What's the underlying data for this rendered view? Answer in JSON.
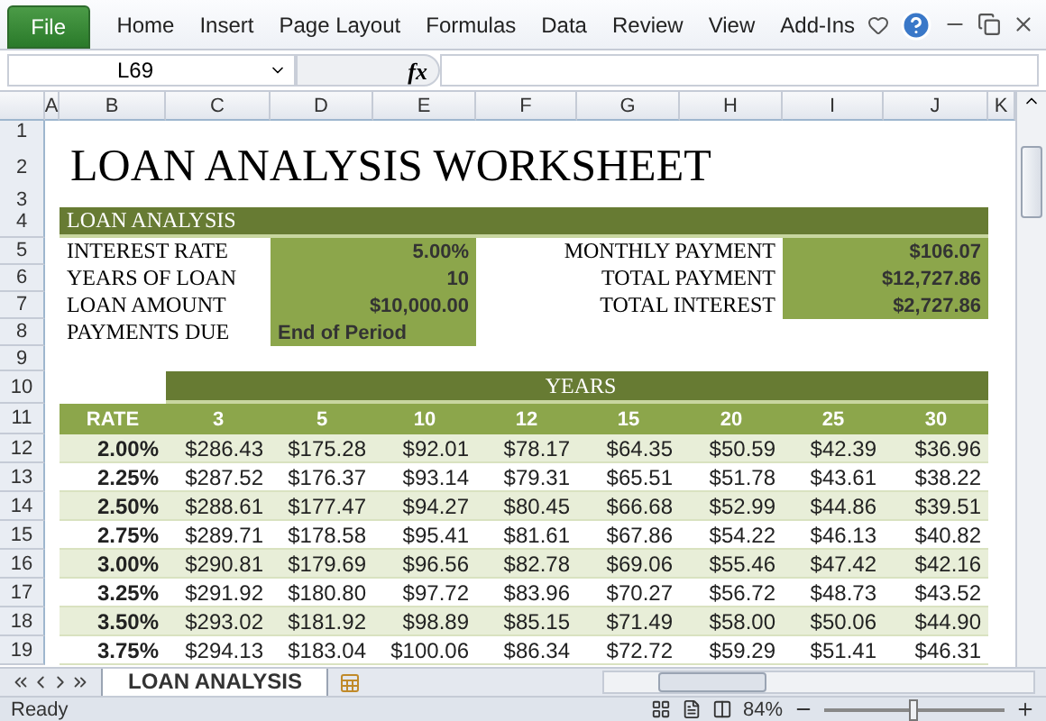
{
  "ribbon": {
    "file_tab": "File",
    "tabs": [
      "Home",
      "Insert",
      "Page Layout",
      "Formulas",
      "Data",
      "Review",
      "View",
      "Add-Ins"
    ]
  },
  "formula_bar": {
    "name_box": "L69",
    "function_label": "fx"
  },
  "columns": [
    "A",
    "B",
    "C",
    "D",
    "E",
    "F",
    "G",
    "H",
    "I",
    "J",
    "K"
  ],
  "row_numbers": [
    "1",
    "2",
    "3",
    "4",
    "5",
    "6",
    "7",
    "8",
    "9",
    "10",
    "11",
    "12",
    "13",
    "14",
    "15",
    "16",
    "17",
    "18",
    "19"
  ],
  "title": "LOAN ANALYSIS WORKSHEET",
  "section": "LOAN ANALYSIS",
  "inputs": [
    {
      "label": "INTEREST RATE",
      "value": "5.00%",
      "kind": "number"
    },
    {
      "label": "YEARS OF LOAN",
      "value": "10",
      "kind": "number"
    },
    {
      "label": "LOAN AMOUNT",
      "value": "$10,000.00",
      "kind": "number"
    },
    {
      "label": "PAYMENTS DUE",
      "value": "End of Period",
      "kind": "text"
    }
  ],
  "outputs": [
    {
      "label": "MONTHLY PAYMENT",
      "value": "$106.07"
    },
    {
      "label": "TOTAL PAYMENT",
      "value": "$12,727.86"
    },
    {
      "label": "TOTAL INTEREST",
      "value": "$2,727.86"
    }
  ],
  "years_header": "YEARS",
  "table_header": [
    "RATE",
    "3",
    "5",
    "10",
    "12",
    "15",
    "20",
    "25",
    "30"
  ],
  "table_rows": [
    {
      "rate": "2.00%",
      "values": [
        "$286.43",
        "$175.28",
        "$92.01",
        "$78.17",
        "$64.35",
        "$50.59",
        "$42.39",
        "$36.96"
      ]
    },
    {
      "rate": "2.25%",
      "values": [
        "$287.52",
        "$176.37",
        "$93.14",
        "$79.31",
        "$65.51",
        "$51.78",
        "$43.61",
        "$38.22"
      ]
    },
    {
      "rate": "2.50%",
      "values": [
        "$288.61",
        "$177.47",
        "$94.27",
        "$80.45",
        "$66.68",
        "$52.99",
        "$44.86",
        "$39.51"
      ]
    },
    {
      "rate": "2.75%",
      "values": [
        "$289.71",
        "$178.58",
        "$95.41",
        "$81.61",
        "$67.86",
        "$54.22",
        "$46.13",
        "$40.82"
      ]
    },
    {
      "rate": "3.00%",
      "values": [
        "$290.81",
        "$179.69",
        "$96.56",
        "$82.78",
        "$69.06",
        "$55.46",
        "$47.42",
        "$42.16"
      ]
    },
    {
      "rate": "3.25%",
      "values": [
        "$291.92",
        "$180.80",
        "$97.72",
        "$83.96",
        "$70.27",
        "$56.72",
        "$48.73",
        "$43.52"
      ]
    },
    {
      "rate": "3.50%",
      "values": [
        "$293.02",
        "$181.92",
        "$98.89",
        "$85.15",
        "$71.49",
        "$58.00",
        "$50.06",
        "$44.90"
      ]
    },
    {
      "rate": "3.75%",
      "values": [
        "$294.13",
        "$183.04",
        "$100.06",
        "$86.34",
        "$72.72",
        "$59.29",
        "$51.41",
        "$46.31"
      ]
    }
  ],
  "sheet_tabs": [
    {
      "label": "LOAN ANALYSIS",
      "selected": true
    }
  ],
  "status_bar": {
    "status": "Ready",
    "zoom": "84%",
    "zoom_slider": {
      "level": 0.5
    }
  }
}
